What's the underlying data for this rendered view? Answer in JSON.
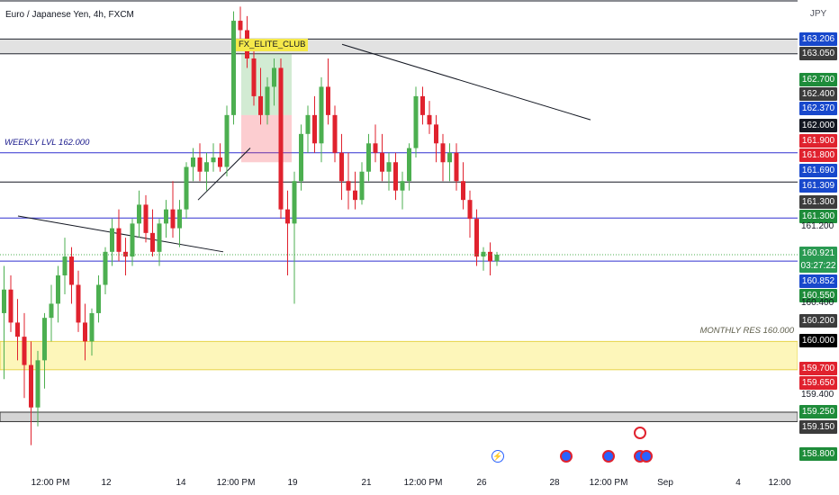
{
  "chart": {
    "title": "Euro / Japanese Yen, 4h, FXCM",
    "currency": "JPY",
    "weekly_label": "WEEKLY LVL 162.000",
    "monthly_label": "MONTHLY RES 160.000",
    "tag": "FX_ELITE_CLUB",
    "colors": {
      "up": "#089981",
      "down": "#f23645",
      "up_fill": "#4caf50",
      "down_fill": "#e0222e",
      "hline_blue": "#3030d0",
      "hline_black": "#131722"
    }
  },
  "price_axis": {
    "labels": [
      {
        "text": "163.206",
        "bg": "#1848cc"
      },
      {
        "text": "163.050",
        "bg": "#3c3c3c"
      },
      {
        "text": "162.700",
        "bg": "#1e8c3a"
      },
      {
        "text": "162.400",
        "bg": "#3c3c3c"
      },
      {
        "text": "162.370",
        "bg": "#1848cc"
      },
      {
        "text": "162.000",
        "bg": "#131722"
      },
      {
        "text": "161.900",
        "bg": "#e0222e"
      },
      {
        "text": "161.800",
        "bg": "#e0222e"
      },
      {
        "text": "161.690",
        "bg": "#1848cc"
      },
      {
        "text": "161.309",
        "bg": "#1848cc"
      },
      {
        "text": "161.300",
        "bg": "#3c3c3c"
      },
      {
        "text": "161.300",
        "bg": "#1e8c3a"
      },
      {
        "text": "161.200",
        "bg": ""
      },
      {
        "text": "160.921",
        "bg": "#2a9a52"
      },
      {
        "text": "03:27:22",
        "bg": "#2a9a52"
      },
      {
        "text": "160.852",
        "bg": "#1848cc"
      },
      {
        "text": "160.550",
        "bg": "#1e8c3a"
      },
      {
        "text": "160.400",
        "bg": ""
      },
      {
        "text": "160.200",
        "bg": "#3c3c3c"
      },
      {
        "text": "160.000",
        "bg": "#000000"
      },
      {
        "text": "159.700",
        "bg": "#e0222e"
      },
      {
        "text": "159.650",
        "bg": "#e0222e"
      },
      {
        "text": "159.400",
        "bg": ""
      },
      {
        "text": "159.250",
        "bg": "#1e8c3a"
      },
      {
        "text": "159.150",
        "bg": "#3c3c3c"
      },
      {
        "text": "158.800",
        "bg": "#1e8c3a"
      }
    ]
  },
  "time_axis": {
    "labels": [
      "12:00 PM",
      "12",
      "14",
      "12:00 PM",
      "19",
      "21",
      "12:00 PM",
      "26",
      "28",
      "12:00 PM",
      "Sep",
      "4",
      "12:00"
    ]
  },
  "chart_data": {
    "type": "candlestick",
    "series": [
      {
        "name": "EURJPY 4h",
        "ohlc": [
          [
            160.3,
            160.8,
            159.6,
            160.55
          ],
          [
            160.55,
            160.7,
            160.1,
            160.2
          ],
          [
            160.2,
            160.45,
            159.8,
            160.05
          ],
          [
            160.05,
            160.3,
            159.4,
            159.75
          ],
          [
            159.75,
            160.0,
            158.9,
            159.3
          ],
          [
            159.3,
            159.9,
            159.1,
            159.8
          ],
          [
            159.8,
            160.3,
            159.5,
            160.25
          ],
          [
            160.25,
            160.6,
            160.0,
            160.4
          ],
          [
            160.4,
            160.8,
            160.2,
            160.7
          ],
          [
            160.7,
            161.1,
            160.5,
            160.9
          ],
          [
            160.9,
            161.0,
            160.4,
            160.6
          ],
          [
            160.6,
            160.75,
            160.1,
            160.2
          ],
          [
            160.2,
            160.4,
            159.8,
            160.0
          ],
          [
            160.0,
            160.35,
            159.85,
            160.3
          ],
          [
            160.3,
            160.7,
            160.2,
            160.6
          ],
          [
            160.6,
            161.0,
            160.5,
            160.95
          ],
          [
            160.95,
            161.3,
            160.8,
            161.2
          ],
          [
            161.2,
            161.4,
            160.85,
            160.95
          ],
          [
            160.95,
            161.1,
            160.7,
            160.9
          ],
          [
            160.9,
            161.3,
            160.8,
            161.25
          ],
          [
            161.25,
            161.6,
            161.1,
            161.45
          ],
          [
            161.45,
            161.55,
            161.05,
            161.15
          ],
          [
            161.15,
            161.4,
            160.9,
            160.95
          ],
          [
            160.95,
            161.3,
            160.8,
            161.25
          ],
          [
            161.25,
            161.5,
            161.1,
            161.4
          ],
          [
            161.4,
            161.7,
            161.1,
            161.2
          ],
          [
            161.2,
            161.5,
            161.0,
            161.4
          ],
          [
            161.4,
            161.9,
            161.3,
            161.85
          ],
          [
            161.85,
            162.05,
            161.7,
            161.95
          ],
          [
            161.95,
            162.1,
            161.7,
            161.8
          ],
          [
            161.8,
            162.0,
            161.6,
            161.9
          ],
          [
            161.9,
            162.1,
            161.8,
            161.95
          ],
          [
            161.95,
            162.1,
            161.8,
            161.85
          ],
          [
            161.85,
            162.5,
            161.75,
            162.4
          ],
          [
            162.4,
            163.5,
            162.3,
            163.4
          ],
          [
            163.4,
            163.55,
            163.1,
            163.3
          ],
          [
            163.3,
            163.45,
            162.9,
            163.0
          ],
          [
            163.0,
            163.2,
            162.5,
            162.6
          ],
          [
            162.6,
            162.9,
            162.3,
            162.4
          ],
          [
            162.4,
            162.8,
            162.3,
            162.7
          ],
          [
            162.7,
            163.0,
            162.5,
            162.9
          ],
          [
            162.9,
            163.0,
            161.3,
            161.4
          ],
          [
            161.4,
            161.6,
            160.7,
            161.25
          ],
          [
            161.25,
            161.8,
            160.4,
            161.7
          ],
          [
            161.7,
            162.3,
            161.6,
            162.2
          ],
          [
            162.2,
            162.5,
            162.0,
            162.4
          ],
          [
            162.4,
            162.6,
            162.0,
            162.1
          ],
          [
            162.1,
            162.8,
            161.9,
            162.7
          ],
          [
            162.7,
            163.0,
            162.3,
            162.4
          ],
          [
            162.4,
            162.5,
            161.9,
            162.0
          ],
          [
            162.0,
            162.2,
            161.5,
            161.7
          ],
          [
            161.7,
            162.0,
            161.4,
            161.6
          ],
          [
            161.6,
            161.8,
            161.4,
            161.5
          ],
          [
            161.5,
            161.9,
            161.45,
            161.8
          ],
          [
            161.8,
            162.2,
            161.7,
            162.1
          ],
          [
            162.1,
            162.3,
            161.9,
            162.0
          ],
          [
            162.0,
            162.2,
            161.7,
            161.8
          ],
          [
            161.8,
            162.0,
            161.6,
            161.9
          ],
          [
            161.9,
            162.0,
            161.5,
            161.6
          ],
          [
            161.6,
            161.8,
            161.4,
            161.7
          ],
          [
            161.7,
            162.1,
            161.6,
            162.05
          ],
          [
            162.05,
            162.7,
            161.95,
            162.6
          ],
          [
            162.6,
            162.7,
            162.3,
            162.4
          ],
          [
            162.4,
            162.55,
            162.2,
            162.3
          ],
          [
            162.3,
            162.4,
            161.9,
            162.1
          ],
          [
            162.1,
            162.2,
            161.7,
            161.9
          ],
          [
            161.9,
            162.1,
            161.7,
            162.0
          ],
          [
            162.0,
            162.1,
            161.6,
            161.7
          ],
          [
            161.7,
            161.9,
            161.4,
            161.5
          ],
          [
            161.5,
            161.6,
            161.1,
            161.3
          ],
          [
            161.3,
            161.4,
            160.8,
            160.9
          ],
          [
            160.9,
            161.0,
            160.75,
            160.95
          ],
          [
            160.95,
            161.05,
            160.7,
            160.85
          ],
          [
            160.85,
            160.95,
            160.8,
            160.92
          ]
        ]
      }
    ],
    "ylim": [
      158.62,
      163.62
    ],
    "levels": [
      163.206,
      163.05,
      162.0,
      161.69,
      161.309,
      160.852
    ],
    "zones": [
      {
        "from": 159.7,
        "to": 160.0,
        "color": "yellow"
      },
      {
        "from": 159.15,
        "to": 159.25,
        "color": "gray"
      }
    ]
  }
}
